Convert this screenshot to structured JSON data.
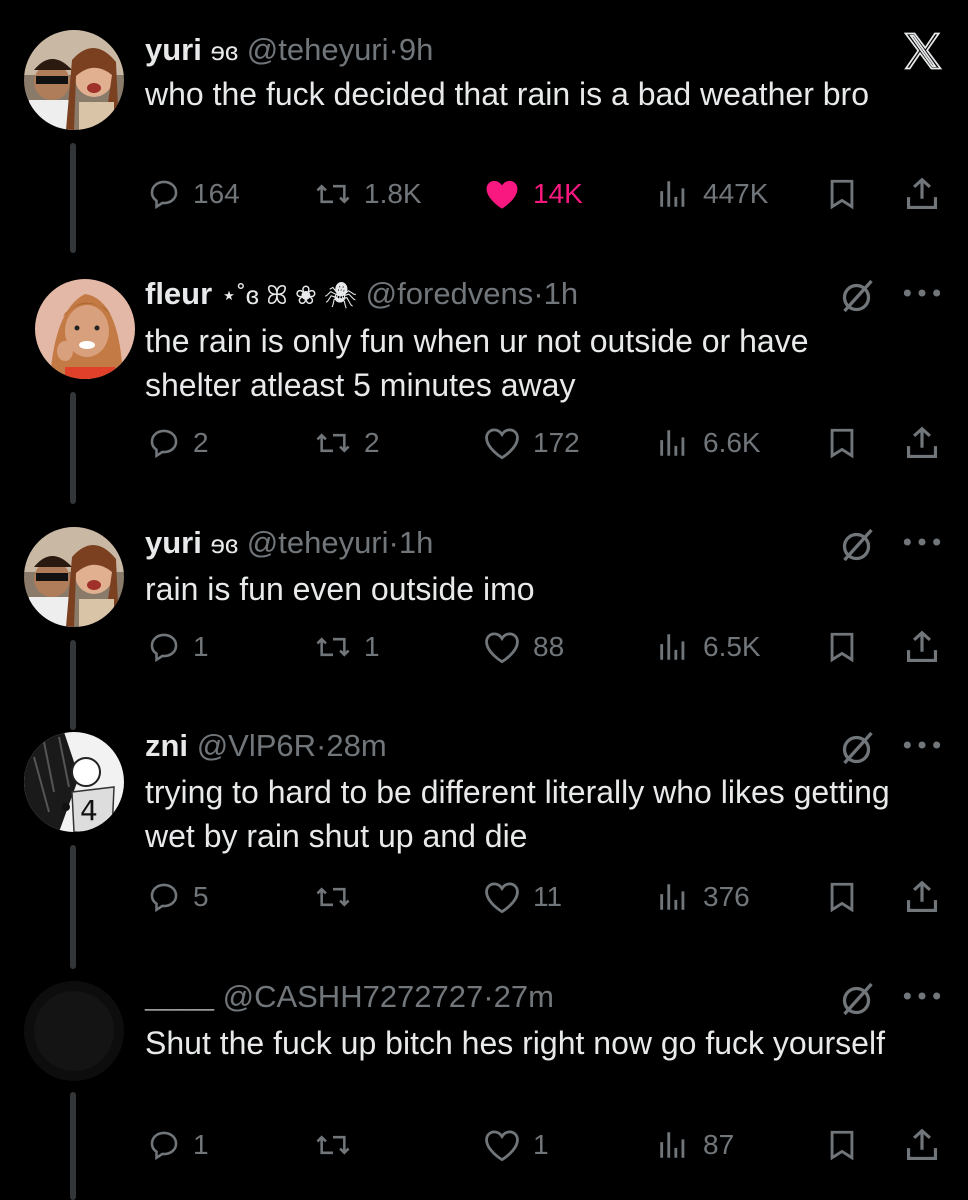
{
  "app": {
    "logo": "x-logo"
  },
  "tweets": [
    {
      "name": "yuri",
      "name_deco": "ɘɞ",
      "handle": "@teheyuri",
      "dot": "·",
      "time": "9h",
      "text": "who the fuck decided that rain is a bad weather bro",
      "replies": "164",
      "retweets": "1.8K",
      "likes": "14K",
      "liked": true,
      "views": "447K"
    },
    {
      "name": "fleur",
      "name_deco": "⋆˚ɞ ꕤ ❀ 🕷",
      "handle": "@foredvens",
      "dot": "·",
      "time": "1h",
      "text": "the rain is only fun when ur not outside or have shelter atleast 5 minutes away",
      "replies": "2",
      "retweets": "2",
      "likes": "172",
      "liked": false,
      "views": "6.6K"
    },
    {
      "name": "yuri",
      "name_deco": "ɘɞ",
      "handle": "@teheyuri",
      "dot": "·",
      "time": "1h",
      "text": "rain is fun even outside imo",
      "replies": "1",
      "retweets": "1",
      "likes": "88",
      "liked": false,
      "views": "6.5K"
    },
    {
      "name": "zni",
      "name_deco": "",
      "handle": "@VlP6R",
      "dot": "·",
      "time": "28m",
      "text": "trying to hard to be different literally who likes getting wet by rain shut up and die",
      "replies": "5",
      "retweets": "",
      "likes": "11",
      "liked": false,
      "views": "376"
    },
    {
      "name": "____",
      "name_deco": "",
      "handle": "@CASHH7272727",
      "dot": "·",
      "time": "27m",
      "text": "Shut the fuck up bitch hes right now go fuck yourself",
      "replies": "1",
      "retweets": "",
      "likes": "1",
      "liked": false,
      "views": "87"
    }
  ],
  "icons": {
    "reply": "reply-icon",
    "retweet": "retweet-icon",
    "like": "heart-icon",
    "views": "views-icon",
    "bookmark": "bookmark-icon",
    "share": "share-icon",
    "grok": "grok-icon",
    "more": "more-icon"
  },
  "colors": {
    "background": "#000000",
    "text": "#e7e9ea",
    "muted": "#71767b",
    "like_active": "#f91880",
    "thread_line": "#333639"
  }
}
